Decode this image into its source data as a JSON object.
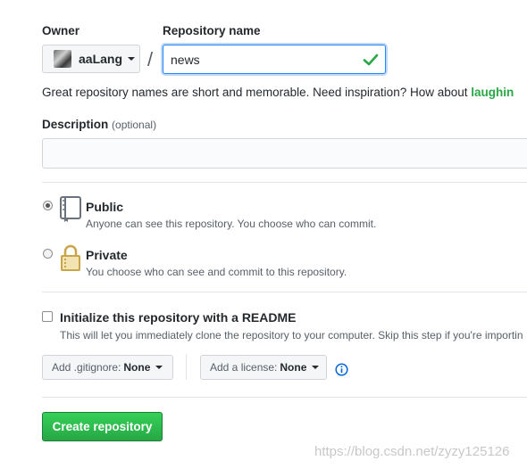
{
  "owner": {
    "label": "Owner",
    "selected": "aaLang"
  },
  "repository_name": {
    "label": "Repository name",
    "value": "news",
    "separator": "/"
  },
  "name_hint": {
    "text": "Great repository names are short and memorable. Need inspiration? How about ",
    "suggestion": "laughin"
  },
  "description": {
    "label": "Description",
    "optional": "(optional)",
    "value": ""
  },
  "visibility": {
    "public": {
      "title": "Public",
      "note": "Anyone can see this repository. You choose who can commit.",
      "selected": true,
      "icon": "repo-book-icon"
    },
    "private": {
      "title": "Private",
      "note": "You choose who can see and commit to this repository.",
      "selected": false,
      "icon": "lock-icon"
    }
  },
  "readme": {
    "title": "Initialize this repository with a README",
    "note": "This will let you immediately clone the repository to your computer. Skip this step if you're importin",
    "checked": false
  },
  "gitignore": {
    "prefix": "Add .gitignore:",
    "value": "None"
  },
  "license": {
    "prefix": "Add a license:",
    "value": "None"
  },
  "create_button": "Create repository",
  "watermark": "https://blog.csdn.net/zyzy125126",
  "colors": {
    "accent_green": "#28a745",
    "focus_blue": "#2188ff",
    "info_blue": "#0366d6"
  }
}
